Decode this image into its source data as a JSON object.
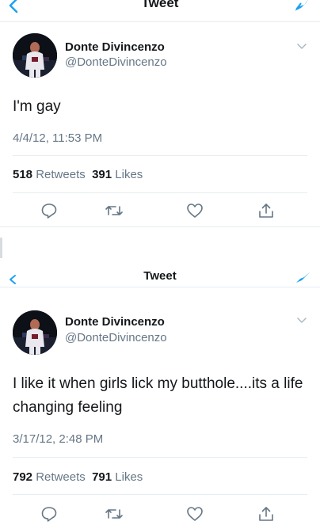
{
  "colors": {
    "accent": "#1da1f2",
    "text": "#14171a",
    "muted": "#657786",
    "border": "#e6ecf0"
  },
  "tweets": [
    {
      "nav_title": "Tweet",
      "user": {
        "name": "Donte Divincenzo",
        "handle": "@DonteDivincenzo"
      },
      "text": "I'm gay",
      "timestamp": "4/4/12, 11:53 PM",
      "stats": {
        "retweets_count": "518",
        "retweets_label": "Retweets",
        "likes_count": "391",
        "likes_label": "Likes"
      }
    },
    {
      "nav_title": "Tweet",
      "user": {
        "name": "Donte Divincenzo",
        "handle": "@DonteDivincenzo"
      },
      "text": "I like it when girls lick my butthole....its a life changing feeling",
      "timestamp": "3/17/12, 2:48 PM",
      "stats": {
        "retweets_count": "792",
        "retweets_label": "Retweets",
        "likes_count": "791",
        "likes_label": "Likes"
      }
    }
  ],
  "icons": {
    "back": "back-arrow-icon",
    "compose": "compose-icon",
    "chevron": "chevron-down-icon",
    "reply": "reply-icon",
    "retweet": "retweet-icon",
    "like": "heart-icon",
    "share": "share-icon"
  }
}
